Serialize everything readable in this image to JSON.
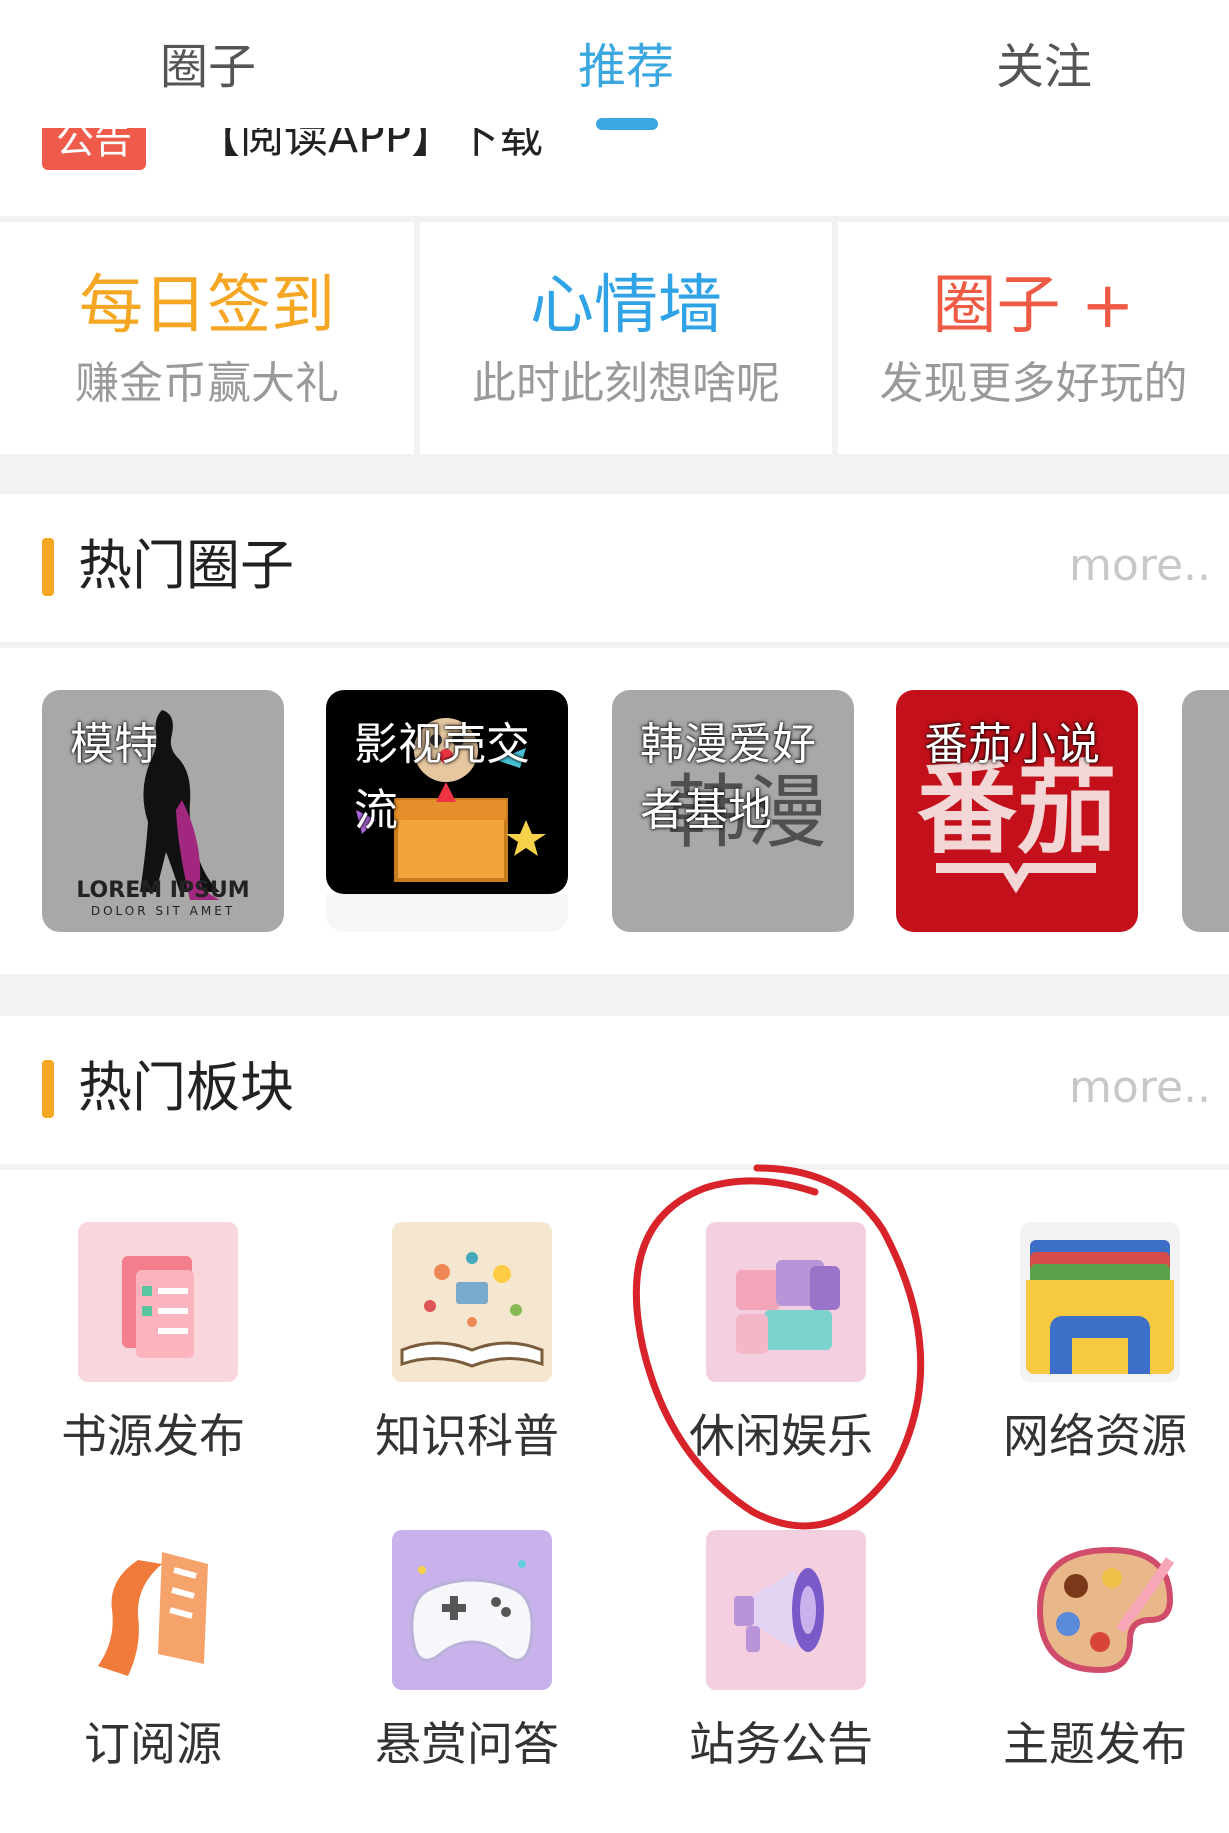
{
  "tabs": [
    {
      "label": "圈子"
    },
    {
      "label": "推荐"
    },
    {
      "label": "关注"
    }
  ],
  "notice": {
    "badge": "公告",
    "text": "【阅读APP】下载"
  },
  "quick_links": [
    {
      "title": "每日签到",
      "subtitle": "赚金币赢大礼",
      "color": "#f5a623"
    },
    {
      "title": "心情墙",
      "subtitle": "此时此刻想啥呢",
      "color": "#2fa3e6"
    },
    {
      "title": "圈子 +",
      "subtitle": "发现更多好玩的",
      "color": "#ef5a45"
    }
  ],
  "hot_circles": {
    "title": "热门圈子",
    "more": "more..",
    "items": [
      {
        "label": "模特",
        "logo_text": "LOREM IPSUM",
        "logo_sub": "DOLOR SIT AMET"
      },
      {
        "label": "影视壳交流"
      },
      {
        "label": "韩漫爱好者基地"
      },
      {
        "label": "番茄小说",
        "logo_text": "番茄"
      }
    ]
  },
  "hot_blocks": {
    "title": "热门板块",
    "more": "more..",
    "items": [
      {
        "label": "书源发布",
        "icon": "document-list-icon"
      },
      {
        "label": "知识科普",
        "icon": "open-book-icon"
      },
      {
        "label": "休闲娱乐",
        "icon": "blocks-icon"
      },
      {
        "label": "网络资源",
        "icon": "folder-icon"
      },
      {
        "label": "订阅源",
        "icon": "subscribe-icon"
      },
      {
        "label": "悬赏问答",
        "icon": "gamepad-icon"
      },
      {
        "label": "站务公告",
        "icon": "megaphone-icon"
      },
      {
        "label": "主题发布",
        "icon": "palette-icon"
      }
    ]
  },
  "colors": {
    "accent_blue": "#3aa7e0",
    "section_bar": "#f5a623",
    "annotation_red": "#d8232a"
  }
}
